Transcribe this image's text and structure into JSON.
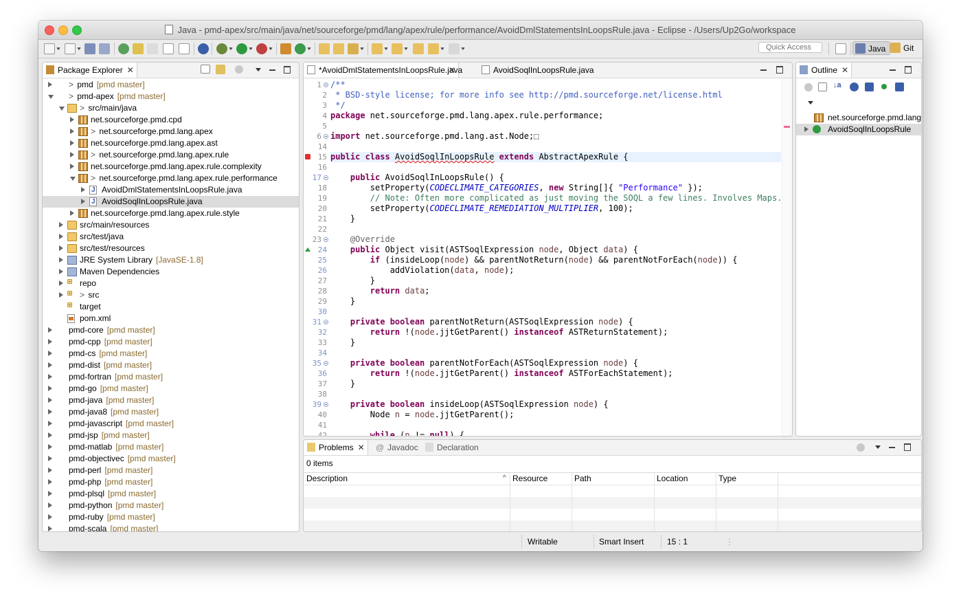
{
  "window": {
    "title": "Java - pmd-apex/src/main/java/net/sourceforge/pmd/lang/apex/rule/performance/AvoidDmlStatementsInLoopsRule.java - Eclipse - /Users/Up2Go/workspace"
  },
  "toolbar": {
    "quick_access_placeholder": "Quick Access",
    "perspectives": [
      {
        "label": "Java",
        "icon": "java-perspective-icon",
        "active": true
      },
      {
        "label": "Git",
        "icon": "git-perspective-icon",
        "active": false
      }
    ]
  },
  "package_explorer": {
    "tab_label": "Package Explorer",
    "rows": [
      {
        "label": "pmd",
        "prefix": "> ",
        "deco": "[pmd master]",
        "icon": "project",
        "level": 0,
        "twisty": "closed"
      },
      {
        "label": "pmd-apex",
        "prefix": "> ",
        "deco": "[pmd master]",
        "icon": "project",
        "level": 0,
        "twisty": "open"
      },
      {
        "label": "src/main/java",
        "prefix": "> ",
        "deco": "",
        "icon": "srcf",
        "level": 1,
        "twisty": "open"
      },
      {
        "label": "net.sourceforge.pmd.cpd",
        "prefix": "",
        "deco": "",
        "icon": "pkg",
        "level": 2,
        "twisty": "closed"
      },
      {
        "label": "net.sourceforge.pmd.lang.apex",
        "prefix": "> ",
        "deco": "",
        "icon": "pkg",
        "level": 2,
        "twisty": "closed"
      },
      {
        "label": "net.sourceforge.pmd.lang.apex.ast",
        "prefix": "",
        "deco": "",
        "icon": "pkg",
        "level": 2,
        "twisty": "closed"
      },
      {
        "label": "net.sourceforge.pmd.lang.apex.rule",
        "prefix": "> ",
        "deco": "",
        "icon": "pkg",
        "level": 2,
        "twisty": "closed"
      },
      {
        "label": "net.sourceforge.pmd.lang.apex.rule.complexity",
        "prefix": "",
        "deco": "",
        "icon": "pkg",
        "level": 2,
        "twisty": "closed"
      },
      {
        "label": "net.sourceforge.pmd.lang.apex.rule.performance",
        "prefix": "> ",
        "deco": "",
        "icon": "pkg",
        "level": 2,
        "twisty": "open"
      },
      {
        "label": "AvoidDmlStatementsInLoopsRule.java",
        "prefix": "",
        "deco": "",
        "icon": "jfile",
        "level": 3,
        "twisty": "closed"
      },
      {
        "label": "AvoidSoqlInLoopsRule.java",
        "prefix": "",
        "deco": "",
        "icon": "jfile",
        "level": 3,
        "twisty": "closed",
        "selected": true
      },
      {
        "label": "net.sourceforge.pmd.lang.apex.rule.style",
        "prefix": "",
        "deco": "",
        "icon": "pkg",
        "level": 2,
        "twisty": "closed"
      },
      {
        "label": "src/main/resources",
        "prefix": "",
        "deco": "",
        "icon": "srcf",
        "level": 1,
        "twisty": "closed"
      },
      {
        "label": "src/test/java",
        "prefix": "",
        "deco": "",
        "icon": "srcf",
        "level": 1,
        "twisty": "closed"
      },
      {
        "label": "src/test/resources",
        "prefix": "",
        "deco": "",
        "icon": "srcf",
        "level": 1,
        "twisty": "closed"
      },
      {
        "label": "JRE System Library",
        "prefix": "",
        "deco": "[JavaSE-1.8]",
        "icon": "lib",
        "level": 1,
        "twisty": "closed"
      },
      {
        "label": "Maven Dependencies",
        "prefix": "",
        "deco": "",
        "icon": "lib",
        "level": 1,
        "twisty": "closed"
      },
      {
        "label": "repo",
        "prefix": "",
        "deco": "",
        "icon": "fold",
        "level": 1,
        "twisty": "closed"
      },
      {
        "label": "src",
        "prefix": "> ",
        "deco": "",
        "icon": "fold",
        "level": 1,
        "twisty": "closed"
      },
      {
        "label": "target",
        "prefix": "",
        "deco": "",
        "icon": "fold",
        "level": 1,
        "twisty": "none"
      },
      {
        "label": "pom.xml",
        "prefix": "",
        "deco": "",
        "icon": "xml",
        "level": 1,
        "twisty": "none"
      },
      {
        "label": "pmd-core",
        "prefix": "",
        "deco": "[pmd master]",
        "icon": "project",
        "level": 0,
        "twisty": "closed"
      },
      {
        "label": "pmd-cpp",
        "prefix": "",
        "deco": "[pmd master]",
        "icon": "project",
        "level": 0,
        "twisty": "closed"
      },
      {
        "label": "pmd-cs",
        "prefix": "",
        "deco": "[pmd master]",
        "icon": "project",
        "level": 0,
        "twisty": "closed"
      },
      {
        "label": "pmd-dist",
        "prefix": "",
        "deco": "[pmd master]",
        "icon": "project",
        "level": 0,
        "twisty": "closed"
      },
      {
        "label": "pmd-fortran",
        "prefix": "",
        "deco": "[pmd master]",
        "icon": "project",
        "level": 0,
        "twisty": "closed"
      },
      {
        "label": "pmd-go",
        "prefix": "",
        "deco": "[pmd master]",
        "icon": "project",
        "level": 0,
        "twisty": "closed"
      },
      {
        "label": "pmd-java",
        "prefix": "",
        "deco": "[pmd master]",
        "icon": "project",
        "level": 0,
        "twisty": "closed"
      },
      {
        "label": "pmd-java8",
        "prefix": "",
        "deco": "[pmd master]",
        "icon": "project",
        "level": 0,
        "twisty": "closed"
      },
      {
        "label": "pmd-javascript",
        "prefix": "",
        "deco": "[pmd master]",
        "icon": "project",
        "level": 0,
        "twisty": "closed"
      },
      {
        "label": "pmd-jsp",
        "prefix": "",
        "deco": "[pmd master]",
        "icon": "project",
        "level": 0,
        "twisty": "closed"
      },
      {
        "label": "pmd-matlab",
        "prefix": "",
        "deco": "[pmd master]",
        "icon": "project",
        "level": 0,
        "twisty": "closed"
      },
      {
        "label": "pmd-objectivec",
        "prefix": "",
        "deco": "[pmd master]",
        "icon": "project",
        "level": 0,
        "twisty": "closed"
      },
      {
        "label": "pmd-perl",
        "prefix": "",
        "deco": "[pmd master]",
        "icon": "project",
        "level": 0,
        "twisty": "closed"
      },
      {
        "label": "pmd-php",
        "prefix": "",
        "deco": "[pmd master]",
        "icon": "project",
        "level": 0,
        "twisty": "closed"
      },
      {
        "label": "pmd-plsql",
        "prefix": "",
        "deco": "[pmd master]",
        "icon": "project",
        "level": 0,
        "twisty": "closed"
      },
      {
        "label": "pmd-python",
        "prefix": "",
        "deco": "[pmd master]",
        "icon": "project",
        "level": 0,
        "twisty": "closed"
      },
      {
        "label": "pmd-ruby",
        "prefix": "",
        "deco": "[pmd master]",
        "icon": "project",
        "level": 0,
        "twisty": "closed"
      },
      {
        "label": "pmd-scala",
        "prefix": "",
        "deco": "[pmd master]",
        "icon": "project",
        "level": 0,
        "twisty": "closed"
      }
    ]
  },
  "editor": {
    "tabs": [
      {
        "label": "*AvoidDmlStatementsInLoopsRule.java",
        "active": true
      },
      {
        "label": "AvoidSoqlInLoopsRule.java",
        "active": false
      }
    ],
    "current_line": "15",
    "lines": [
      {
        "n": "1",
        "fold": true,
        "segs": [
          [
            "jd",
            "/**"
          ]
        ]
      },
      {
        "n": "2",
        "segs": [
          [
            "jd",
            " * BSD-style license; for more info see http://pmd.sourceforge.net/license.html"
          ]
        ]
      },
      {
        "n": "3",
        "segs": [
          [
            "jd",
            " */"
          ]
        ]
      },
      {
        "n": "4",
        "segs": [
          [
            "kw",
            "package"
          ],
          [
            "",
            " net.sourceforge.pmd.lang.apex.rule.performance;"
          ]
        ]
      },
      {
        "n": "5",
        "segs": []
      },
      {
        "n": "6",
        "fold": true,
        "segs": [
          [
            "kw",
            "import"
          ],
          [
            "",
            " net.sourceforge.pmd.lang.ast.Node;"
          ],
          [
            "",
            "⬚"
          ]
        ]
      },
      {
        "n": "14",
        "segs": []
      },
      {
        "n": "15",
        "err": true,
        "segs": [
          [
            "kw",
            "public class "
          ],
          [
            "err",
            "AvoidSoqlInLoopsRule"
          ],
          [
            "",
            " "
          ],
          [
            "kw",
            "extends"
          ],
          [
            "",
            " AbstractApexRule {"
          ]
        ]
      },
      {
        "n": "16",
        "segs": []
      },
      {
        "n": "17",
        "fold": true,
        "blue": true,
        "segs": [
          [
            "",
            "    "
          ],
          [
            "kw",
            "public"
          ],
          [
            "",
            " AvoidSoqlInLoopsRule() {"
          ]
        ]
      },
      {
        "n": "18",
        "segs": [
          [
            "",
            "        setProperty("
          ],
          [
            "fi",
            "CODECLIMATE_CATEGORIES"
          ],
          [
            "",
            ", "
          ],
          [
            "kw",
            "new"
          ],
          [
            "",
            " String[]{ "
          ],
          [
            "st",
            "\"Performance\""
          ],
          [
            "",
            " });"
          ]
        ]
      },
      {
        "n": "19",
        "segs": [
          [
            "",
            "        "
          ],
          [
            "cm",
            "// Note: Often more complicated as just moving the SOQL a few lines. Involves Maps..."
          ]
        ]
      },
      {
        "n": "20",
        "segs": [
          [
            "",
            "        setProperty("
          ],
          [
            "fi",
            "CODECLIMATE_REMEDIATION_MULTIPLIER"
          ],
          [
            "",
            ", 100);"
          ]
        ]
      },
      {
        "n": "21",
        "segs": [
          [
            "",
            "    }"
          ]
        ]
      },
      {
        "n": "22",
        "segs": []
      },
      {
        "n": "23",
        "fold": true,
        "segs": [
          [
            "",
            "    "
          ],
          [
            "an",
            "@Override"
          ]
        ]
      },
      {
        "n": "24",
        "blue": true,
        "ovr": true,
        "segs": [
          [
            "",
            "    "
          ],
          [
            "kw",
            "public"
          ],
          [
            "",
            " Object visit(ASTSoqlExpression "
          ],
          [
            "va",
            "node"
          ],
          [
            "",
            ", Object "
          ],
          [
            "va",
            "data"
          ],
          [
            "",
            ") {"
          ]
        ]
      },
      {
        "n": "25",
        "blue": true,
        "segs": [
          [
            "",
            "        "
          ],
          [
            "kw",
            "if"
          ],
          [
            "",
            " (insideLoop("
          ],
          [
            "va",
            "node"
          ],
          [
            "",
            ") && parentNotReturn("
          ],
          [
            "va",
            "node"
          ],
          [
            "",
            ") && parentNotForEach("
          ],
          [
            "va",
            "node"
          ],
          [
            "",
            ")) {"
          ]
        ]
      },
      {
        "n": "26",
        "blue": true,
        "segs": [
          [
            "",
            "            addViolation("
          ],
          [
            "va",
            "data"
          ],
          [
            "",
            ", "
          ],
          [
            "va",
            "node"
          ],
          [
            "",
            ");"
          ]
        ]
      },
      {
        "n": "27",
        "segs": [
          [
            "",
            "        }"
          ]
        ]
      },
      {
        "n": "28",
        "segs": [
          [
            "",
            "        "
          ],
          [
            "kw",
            "return"
          ],
          [
            "",
            " "
          ],
          [
            "va",
            "data"
          ],
          [
            "",
            ";"
          ]
        ]
      },
      {
        "n": "29",
        "segs": [
          [
            "",
            "    }"
          ]
        ]
      },
      {
        "n": "30",
        "blue": true,
        "segs": []
      },
      {
        "n": "31",
        "fold": true,
        "blue": true,
        "segs": [
          [
            "",
            "    "
          ],
          [
            "kw",
            "private boolean"
          ],
          [
            "",
            " parentNotReturn(ASTSoqlExpression "
          ],
          [
            "va",
            "node"
          ],
          [
            "",
            ") {"
          ]
        ]
      },
      {
        "n": "32",
        "blue": true,
        "segs": [
          [
            "",
            "        "
          ],
          [
            "kw",
            "return"
          ],
          [
            "",
            " !("
          ],
          [
            "va",
            "node"
          ],
          [
            "",
            ".jjtGetParent() "
          ],
          [
            "kw",
            "instanceof"
          ],
          [
            "",
            " ASTReturnStatement);"
          ]
        ]
      },
      {
        "n": "33",
        "segs": [
          [
            "",
            "    }"
          ]
        ]
      },
      {
        "n": "34",
        "blue": true,
        "segs": []
      },
      {
        "n": "35",
        "fold": true,
        "blue": true,
        "segs": [
          [
            "",
            "    "
          ],
          [
            "kw",
            "private boolean"
          ],
          [
            "",
            " parentNotForEach(ASTSoqlExpression "
          ],
          [
            "va",
            "node"
          ],
          [
            "",
            ") {"
          ]
        ]
      },
      {
        "n": "36",
        "blue": true,
        "segs": [
          [
            "",
            "        "
          ],
          [
            "kw",
            "return"
          ],
          [
            "",
            " !("
          ],
          [
            "va",
            "node"
          ],
          [
            "",
            ".jjtGetParent() "
          ],
          [
            "kw",
            "instanceof"
          ],
          [
            "",
            " ASTForEachStatement);"
          ]
        ]
      },
      {
        "n": "37",
        "segs": [
          [
            "",
            "    }"
          ]
        ]
      },
      {
        "n": "38",
        "segs": []
      },
      {
        "n": "39",
        "fold": true,
        "blue": true,
        "segs": [
          [
            "",
            "    "
          ],
          [
            "kw",
            "private boolean"
          ],
          [
            "",
            " insideLoop(ASTSoqlExpression "
          ],
          [
            "va",
            "node"
          ],
          [
            "",
            ") {"
          ]
        ]
      },
      {
        "n": "40",
        "segs": [
          [
            "",
            "        Node "
          ],
          [
            "va",
            "n"
          ],
          [
            "",
            " = "
          ],
          [
            "va",
            "node"
          ],
          [
            "",
            ".jjtGetParent();"
          ]
        ]
      },
      {
        "n": "41",
        "segs": []
      },
      {
        "n": "42",
        "segs": [
          [
            "",
            "        "
          ],
          [
            "kw",
            "while"
          ],
          [
            "",
            " ("
          ],
          [
            "va",
            "n"
          ],
          [
            "",
            " != "
          ],
          [
            "kw",
            "null"
          ],
          [
            "",
            ") {"
          ]
        ]
      }
    ]
  },
  "outline": {
    "tab_label": "Outline",
    "items": [
      {
        "label": "net.sourceforge.pmd.lang.apex.rule.performance",
        "icon": "package-icon"
      },
      {
        "label": "AvoidSoqlInLoopsRule",
        "icon": "class-icon",
        "selected": true
      }
    ]
  },
  "problems": {
    "tabs": [
      {
        "label": "Problems",
        "active": true
      },
      {
        "label": "Javadoc",
        "active": false
      },
      {
        "label": "Declaration",
        "active": false
      }
    ],
    "count": "0 items",
    "columns": [
      "Description",
      "Resource",
      "Path",
      "Location",
      "Type"
    ]
  },
  "status": {
    "writable": "Writable",
    "insert_mode": "Smart Insert",
    "position": "15 : 1"
  }
}
